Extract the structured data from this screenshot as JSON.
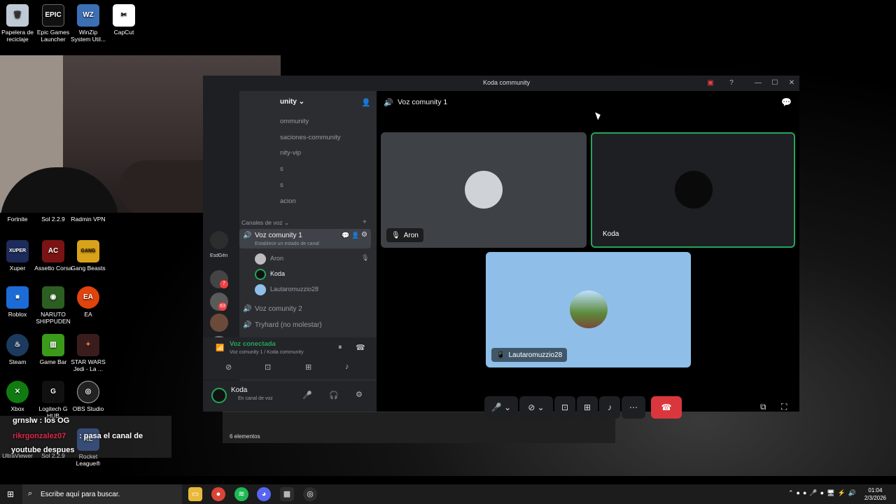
{
  "desktop_icons": [
    {
      "label": "Papelera de reciclaje",
      "icon": "recycle-bin-icon"
    },
    {
      "label": "Epic Games Launcher",
      "icon": "epic-games-icon"
    },
    {
      "label": "WinZip System Util...",
      "icon": "winzip-icon"
    },
    {
      "label": "CapCut",
      "icon": "capcut-icon"
    },
    {
      "label": "Fortnite",
      "icon": "fortnite-icon"
    },
    {
      "label": "Sol 2.2.9",
      "icon": "sol-icon"
    },
    {
      "label": "Radmin VPN",
      "icon": "radmin-icon"
    },
    {
      "label": "Xuper",
      "icon": "xuper-icon"
    },
    {
      "label": "Assetto Corsa",
      "icon": "assetto-icon"
    },
    {
      "label": "Gang Beasts",
      "icon": "gang-beasts-icon"
    },
    {
      "label": "Roblox",
      "icon": "roblox-icon"
    },
    {
      "label": "NARUTO SHIPPUDEN",
      "icon": "naruto-icon"
    },
    {
      "label": "EA",
      "icon": "ea-icon"
    },
    {
      "label": "Steam",
      "icon": "steam-icon"
    },
    {
      "label": "Game Bar",
      "icon": "game-bar-icon"
    },
    {
      "label": "STAR WARS Jedi - La ...",
      "icon": "star-wars-icon"
    },
    {
      "label": "Xbox",
      "icon": "xbox-icon"
    },
    {
      "label": "Logitech G HUB",
      "icon": "logitech-icon"
    },
    {
      "label": "OBS Studio",
      "icon": "obs-icon"
    },
    {
      "label": "UltraViewer",
      "icon": "ultraviewer-icon"
    },
    {
      "label": "Sol 2.2.9",
      "icon": "sol-icon"
    },
    {
      "label": "Rocket League®",
      "icon": "rocket-league-icon"
    }
  ],
  "chat": {
    "line1": "grnslw : los OG",
    "line2_user": "rikrgonzalez07",
    "line2_text": ": pasa el canal de",
    "line3": "youtube despues"
  },
  "discord": {
    "window_title": "Koda community",
    "server_name": "unity",
    "channels": [
      "ommunity",
      "saciones-community",
      "nity-vip",
      "s",
      "s",
      "acion"
    ],
    "voice_header": "Canales de voz",
    "voice_channels": [
      {
        "name": "Voz comunity 1",
        "status": "Establece un estado de canal",
        "active": true
      },
      {
        "name": "Voz comunity 2",
        "active": false
      },
      {
        "name": "Tryhard (no molestar)",
        "active": false
      }
    ],
    "members": [
      "Aron",
      "Koda",
      "Lautaromuzzio28"
    ],
    "guild_short": "EsdGén",
    "badges": [
      "7",
      "63"
    ],
    "rtc": {
      "status": "Voz conectada",
      "location": "Voz comunity 1 / Koda community"
    },
    "user": {
      "name": "Koda",
      "status": "En canal de voz"
    },
    "call": {
      "channel_title": "Voz comunity 1",
      "tiles": [
        {
          "name": "Aron",
          "muted": true
        },
        {
          "name": "Koda",
          "speaking": true
        },
        {
          "name": "Lautaromuzzio28"
        }
      ]
    }
  },
  "explorer": {
    "item_count": "6 elementos"
  },
  "taskbar": {
    "search_placeholder": "Escribe aquí para buscar.",
    "time": "01:04",
    "date": "2/3/2026"
  },
  "colors": {
    "discord_bg": "#1e1f22",
    "panel_bg": "#2b2d31",
    "green": "#23a55a",
    "red": "#da373c",
    "tile_light": "#8fbfe8"
  }
}
